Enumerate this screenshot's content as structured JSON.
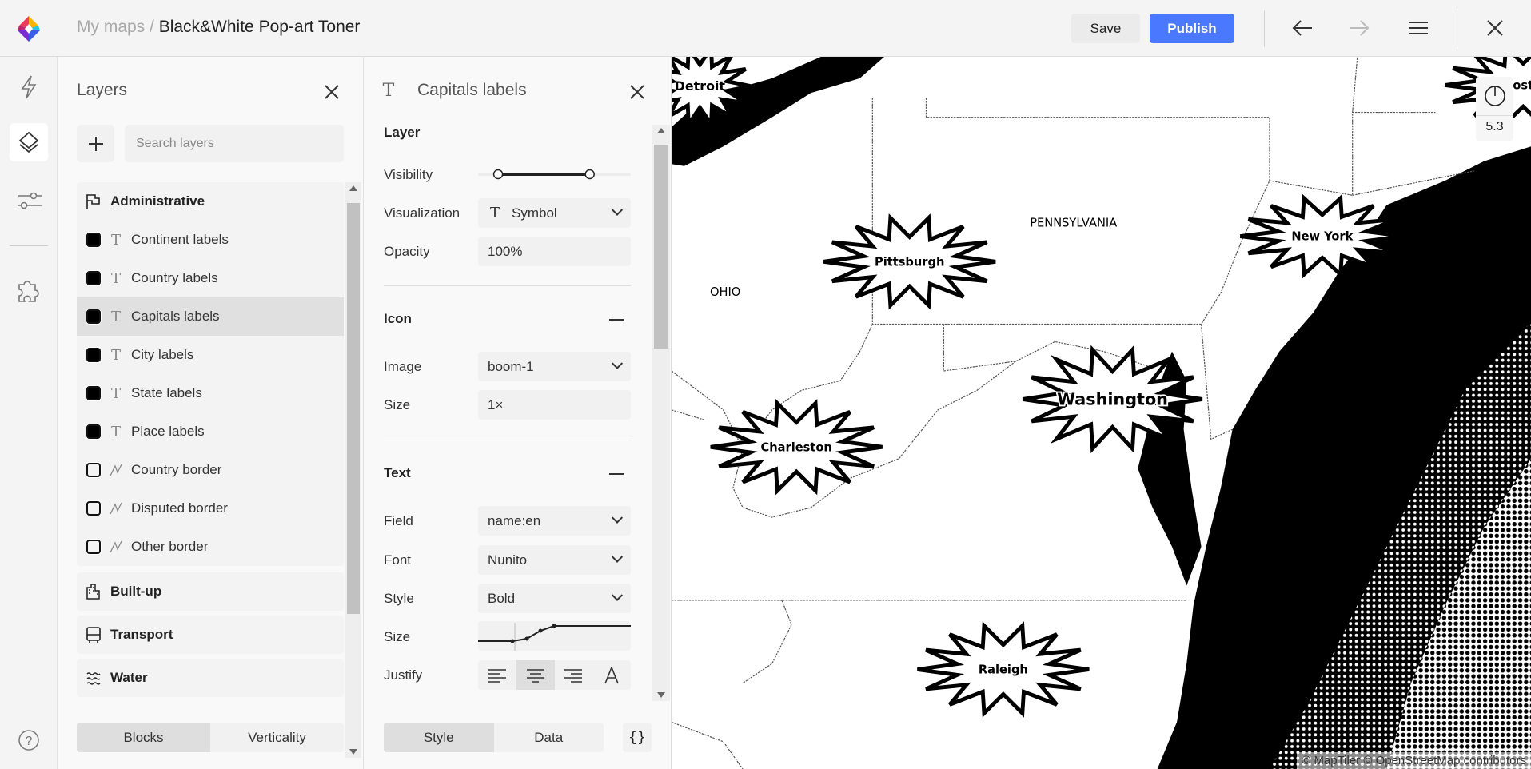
{
  "header": {
    "breadcrumb_root": "My maps",
    "breadcrumb_sep": " / ",
    "map_title": "Black&White Pop-art Toner",
    "save_label": "Save",
    "publish_label": "Publish"
  },
  "colors": {
    "accent": "#4a78ff",
    "map_land": "#ffffff",
    "map_water": "#000000"
  },
  "rail": {
    "items": [
      {
        "icon": "lightning-icon"
      },
      {
        "icon": "layers-icon",
        "active": true
      },
      {
        "icon": "sliders-icon"
      },
      {
        "icon": "puzzle-icon"
      },
      {
        "icon": "help-icon"
      }
    ]
  },
  "layers_panel": {
    "title": "Layers",
    "search_placeholder": "Search layers",
    "groups": [
      {
        "name": "Administrative",
        "icon": "flag-icon",
        "items": [
          {
            "label": "Continent labels",
            "type": "text",
            "filled": true
          },
          {
            "label": "Country labels",
            "type": "text",
            "filled": true
          },
          {
            "label": "Capitals labels",
            "type": "text",
            "filled": true,
            "selected": true
          },
          {
            "label": "City labels",
            "type": "text",
            "filled": true
          },
          {
            "label": "State labels",
            "type": "text",
            "filled": true
          },
          {
            "label": "Place labels",
            "type": "text",
            "filled": true
          },
          {
            "label": "Country border",
            "type": "line",
            "filled": false
          },
          {
            "label": "Disputed border",
            "type": "line",
            "filled": false
          },
          {
            "label": "Other border",
            "type": "line",
            "filled": false
          }
        ]
      },
      {
        "name": "Built-up",
        "icon": "building-icon",
        "items": []
      },
      {
        "name": "Transport",
        "icon": "bus-icon",
        "items": []
      },
      {
        "name": "Water",
        "icon": "water-icon",
        "items": []
      }
    ],
    "tabs": [
      {
        "label": "Blocks",
        "active": true
      },
      {
        "label": "Verticality",
        "active": false
      }
    ]
  },
  "style_panel": {
    "title": "Capitals labels",
    "layer_section": "Layer",
    "visibility_label": "Visibility",
    "visibility_range": [
      0.1,
      0.7
    ],
    "visualization_label": "Visualization",
    "visualization_value": "Symbol",
    "opacity_label": "Opacity",
    "opacity_value": "100%",
    "icon_section": "Icon",
    "image_label": "Image",
    "image_value": "boom-1",
    "icon_size_label": "Size",
    "icon_size_value": "1×",
    "text_section": "Text",
    "field_label": "Field",
    "field_value": "name:en",
    "font_label": "Font",
    "font_value": "Nunito",
    "style_label": "Style",
    "style_value": "Bold",
    "text_size_label": "Size",
    "justify_label": "Justify",
    "justify_selected": "center",
    "tabs": [
      {
        "label": "Style",
        "active": true
      },
      {
        "label": "Data",
        "active": false
      }
    ],
    "json_button": "{}"
  },
  "map": {
    "zoom": "5.3",
    "attribution": "© MapTiler © OpenStreetMap contributors",
    "state_labels": [
      {
        "text": "PENNSYLVANIA"
      },
      {
        "text": "OHIO"
      }
    ],
    "capitals": [
      {
        "text": "Detroit"
      },
      {
        "text": "Pittsburgh"
      },
      {
        "text": "New York"
      },
      {
        "text": "Washington"
      },
      {
        "text": "Charleston"
      },
      {
        "text": "Raleigh"
      },
      {
        "text": "ost"
      }
    ]
  }
}
